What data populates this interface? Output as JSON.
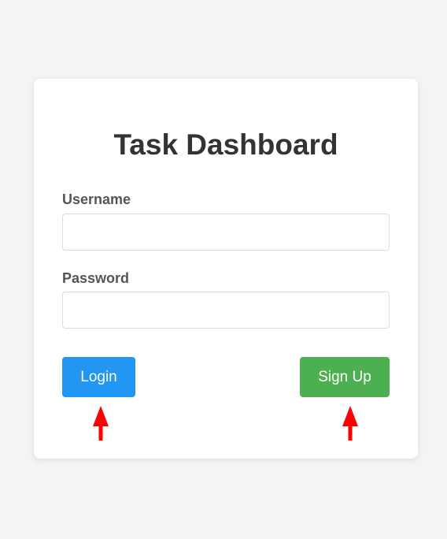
{
  "login_form": {
    "title": "Task Dashboard",
    "username": {
      "label": "Username",
      "value": "",
      "placeholder": ""
    },
    "password": {
      "label": "Password",
      "value": "",
      "placeholder": ""
    },
    "login_label": "Login",
    "signup_label": "Sign Up"
  },
  "annotations": {
    "arrow_icon": "up-arrow-icon",
    "arrow_color": "#ff0000"
  },
  "colors": {
    "login_button": "#2196f3",
    "signup_button": "#4caf50",
    "background": "#f4f4f4",
    "card": "#ffffff"
  }
}
